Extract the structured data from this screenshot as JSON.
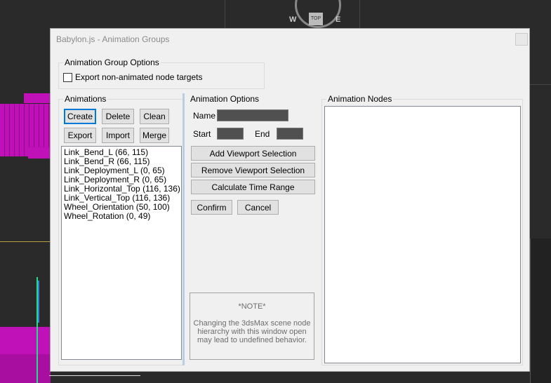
{
  "background": {
    "viewcube": {
      "top_label": "TOP",
      "west": "W",
      "east": "E"
    }
  },
  "window": {
    "title": "Babylon.js - Animation Groups"
  },
  "group_options": {
    "label": "Animation Group Options",
    "export_non_animated": {
      "label": "Export non-animated node targets",
      "checked": false
    }
  },
  "animations": {
    "label": "Animations",
    "buttons": {
      "create": "Create",
      "delete": "Delete",
      "clean": "Clean",
      "export": "Export",
      "import": "Import",
      "merge": "Merge"
    },
    "items": [
      "Link_Bend_L (66, 115)",
      "Link_Bend_R (66, 115)",
      "Link_Deployment_L (0, 65)",
      "Link_Deployment_R (0, 65)",
      "Link_Horizontal_Top (116, 136)",
      "Link_Vertical_Top (116, 136)",
      "Wheel_Orientation (50, 100)",
      "Wheel_Rotation (0, 49)"
    ]
  },
  "options": {
    "label": "Animation Options",
    "name_label": "Name",
    "start_label": "Start",
    "end_label": "End",
    "name_value": "",
    "start_value": "",
    "end_value": "",
    "add_selection": "Add Viewport Selection",
    "remove_selection": "Remove Viewport Selection",
    "calc_time_range": "Calculate Time Range",
    "confirm": "Confirm",
    "cancel": "Cancel",
    "note_title": "*NOTE*",
    "note_text": "Changing the 3dsMax scene node hierarchy with this window open may lead to undefined behavior."
  },
  "nodes": {
    "label": "Animation Nodes"
  },
  "colors": {
    "accent": "#0078d7",
    "dialog_bg": "#f0f0f0",
    "viewport_bg": "#2a2a2a",
    "magenta": "#c010b8"
  }
}
